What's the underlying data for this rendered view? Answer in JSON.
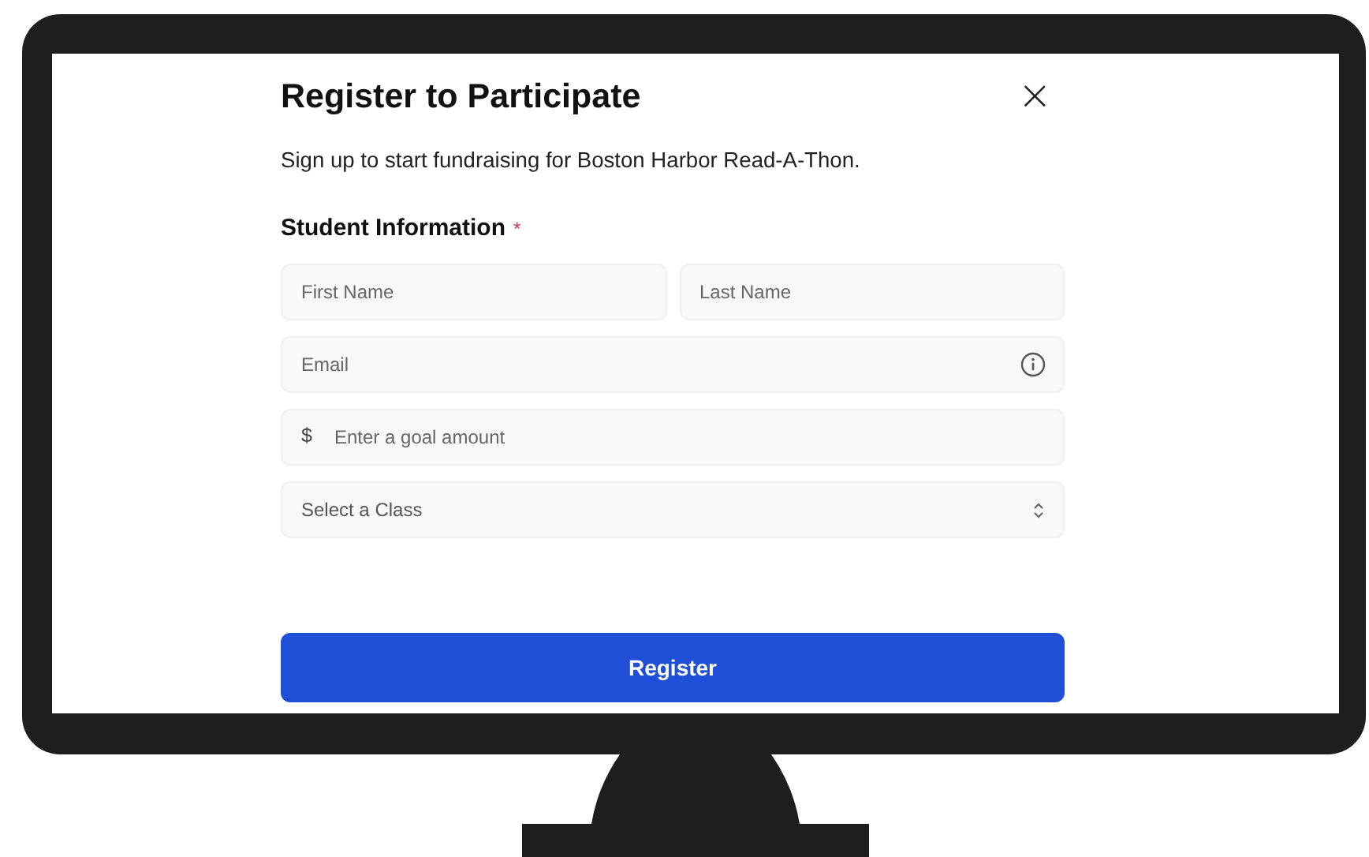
{
  "dialog": {
    "title": "Register to Participate",
    "close": "×",
    "description": "Sign up to start fundraising for Boston Harbor Read-A-Thon.",
    "section": {
      "heading": "Student Information",
      "required_mark": "*"
    },
    "field_rows": [
      [
        {
          "kind": "text",
          "placeholder": "First Name"
        },
        {
          "kind": "text",
          "placeholder": "Last Name"
        }
      ],
      [
        {
          "kind": "email",
          "placeholder": "Email"
        }
      ],
      [
        {
          "kind": "currency",
          "prefix": "$",
          "placeholder": "Enter a goal amount"
        }
      ],
      [
        {
          "kind": "select",
          "placeholder": "Select a Class"
        }
      ]
    ],
    "submit_button": "Register"
  }
}
